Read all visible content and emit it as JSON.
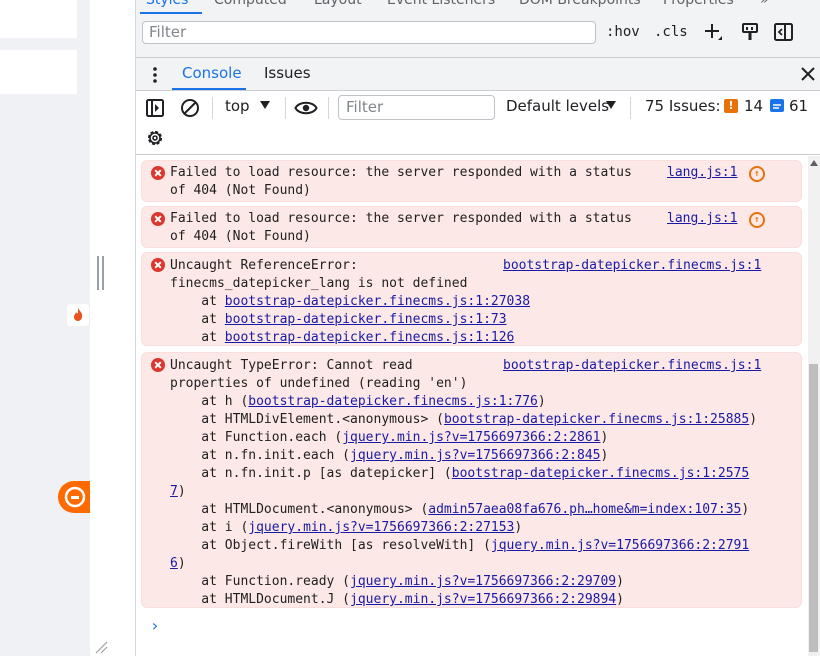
{
  "styles_pane": {
    "tabs": [
      "Styles",
      "Computed",
      "Layout",
      "Event Listeners",
      "DOM Breakpoints",
      "Properties"
    ],
    "more": "»",
    "filter_placeholder": "Filter",
    "hov": ":hov",
    "cls": ".cls"
  },
  "drawer": {
    "tabs": [
      "Console",
      "Issues"
    ],
    "active_tab": "Console"
  },
  "toolbar": {
    "context": "top",
    "filter_placeholder": "Filter",
    "levels": "Default levels",
    "issues_label": "75 Issues:",
    "warnings": "14",
    "infos": "61"
  },
  "colors": {
    "accent": "#1a73e8",
    "error_bg": "#fce8e6",
    "error_icon": "#dc362e",
    "link": "#1a1aa6",
    "warning": "#e8710a"
  },
  "messages": [
    {
      "lines": [
        "Failed to load resource: the server responded with a status",
        "of 404 (Not Found)"
      ],
      "source": "lang.js:1"
    },
    {
      "lines": [
        "Failed to load resource: the server responded with a status",
        "of 404 (Not Found)"
      ],
      "source": "lang.js:1"
    },
    {
      "lines": [
        "Uncaught ReferenceError:",
        "finecms_datepicker_lang is not defined"
      ],
      "source": "bootstrap-datepicker.finecms.js:1",
      "stack": [
        {
          "pre": "    at ",
          "link": "bootstrap-datepicker.finecms.js:1:27038",
          "post": ""
        },
        {
          "pre": "    at ",
          "link": "bootstrap-datepicker.finecms.js:1:73",
          "post": ""
        },
        {
          "pre": "    at ",
          "link": "bootstrap-datepicker.finecms.js:1:126",
          "post": ""
        }
      ]
    },
    {
      "lines": [
        "Uncaught TypeError: Cannot read",
        "properties of undefined (reading 'en')"
      ],
      "source": "bootstrap-datepicker.finecms.js:1",
      "stack": [
        {
          "pre": "    at h (",
          "link": "bootstrap-datepicker.finecms.js:1:776",
          "post": ")"
        },
        {
          "pre": "    at HTMLDivElement.<anonymous> (",
          "link": "bootstrap-datepicker.finecms.js:1:25885",
          "post": ")"
        },
        {
          "pre": "    at Function.each (",
          "link": "jquery.min.js?v=1756697366:2:2861",
          "post": ")"
        },
        {
          "pre": "    at n.fn.init.each (",
          "link": "jquery.min.js?v=1756697366:2:845",
          "post": ")"
        },
        {
          "pre": "    at n.fn.init.p [as datepicker] (",
          "link": "bootstrap-datepicker.finecms.js:1:2575",
          "post": ""
        },
        {
          "pre": "",
          "link": "7",
          "post": ")"
        },
        {
          "pre": "    at HTMLDocument.<anonymous> (",
          "link": "admin57aea08fa676.ph…home&m=index:107:35",
          "post": ")"
        },
        {
          "pre": "    at i (",
          "link": "jquery.min.js?v=1756697366:2:27153",
          "post": ")"
        },
        {
          "pre": "    at Object.fireWith [as resolveWith] (",
          "link": "jquery.min.js?v=1756697366:2:2791",
          "post": ""
        },
        {
          "pre": "",
          "link": "6",
          "post": ")"
        },
        {
          "pre": "    at Function.ready (",
          "link": "jquery.min.js?v=1756697366:2:29709",
          "post": ")"
        },
        {
          "pre": "    at HTMLDocument.J (",
          "link": "jquery.min.js?v=1756697366:2:29894",
          "post": ")"
        }
      ]
    }
  ],
  "prompt": "›"
}
